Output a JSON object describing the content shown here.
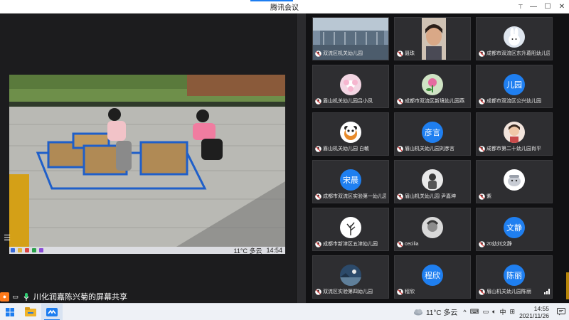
{
  "window": {
    "title": "腾讯会议",
    "controls": [
      "⊤",
      "—",
      "☐",
      "✕"
    ]
  },
  "share": {
    "caption": "川化润嘉陈兴菊的屏幕共享",
    "inner_taskbar": {
      "weather": "11°C 多云",
      "clock": "14:54"
    }
  },
  "participants": [
    {
      "name": "双流区机关幼儿园",
      "avatar_type": "video"
    },
    {
      "name": "聂珠",
      "avatar_type": "video"
    },
    {
      "name": "成都市双流区东升葛阳幼儿园",
      "avatar_type": "image",
      "icon": "rabbit-icon"
    },
    {
      "name": "眉山机关幼儿园吕小凤",
      "avatar_type": "image",
      "icon": "flower-icon"
    },
    {
      "name": "成都市双流区新境幼儿园燕",
      "avatar_type": "image",
      "icon": "plant-icon"
    },
    {
      "name": "成都市双流区公兴幼儿园",
      "avatar_type": "text",
      "avatar_text": "儿园"
    },
    {
      "name": "眉山机关幼儿园 白敏",
      "avatar_type": "image",
      "icon": "panda-icon"
    },
    {
      "name": "眉山机关幼儿园刘彦言",
      "avatar_type": "text",
      "avatar_text": "彦言"
    },
    {
      "name": "成都市第二十幼儿园肖平",
      "avatar_type": "image",
      "icon": "girl-icon"
    },
    {
      "name": "成都市双流区实验第一幼儿园宋晨",
      "avatar_type": "text",
      "avatar_text": "宋晨"
    },
    {
      "name": "眉山机关幼儿园 尹嘉坤",
      "avatar_type": "image",
      "icon": "person-icon"
    },
    {
      "name": "紫",
      "avatar_type": "image",
      "icon": "cartoon-icon"
    },
    {
      "name": "成都市新津区五津幼儿园",
      "avatar_type": "image",
      "icon": "tree-icon"
    },
    {
      "name": "cecilia",
      "avatar_type": "image",
      "icon": "portrait-icon"
    },
    {
      "name": "20幼刘文静",
      "avatar_type": "text",
      "avatar_text": "文静"
    },
    {
      "name": "双流区实验第四幼儿园",
      "avatar_type": "image",
      "icon": "landscape-icon"
    },
    {
      "name": "程欣",
      "avatar_type": "text",
      "avatar_text": "程欣"
    },
    {
      "name": "眉山机关幼儿园陈丽",
      "avatar_type": "text",
      "avatar_text": "陈丽",
      "speaking": true
    }
  ],
  "taskbar": {
    "weather": "11°C  多云",
    "ime": "中",
    "time": "14:55",
    "date": "2021/11/26"
  },
  "colors": {
    "accent": "#1f7ff0",
    "panel_bg": "#111113",
    "tile_bg": "#2e2e31",
    "share_person": "#ff7a1a"
  }
}
